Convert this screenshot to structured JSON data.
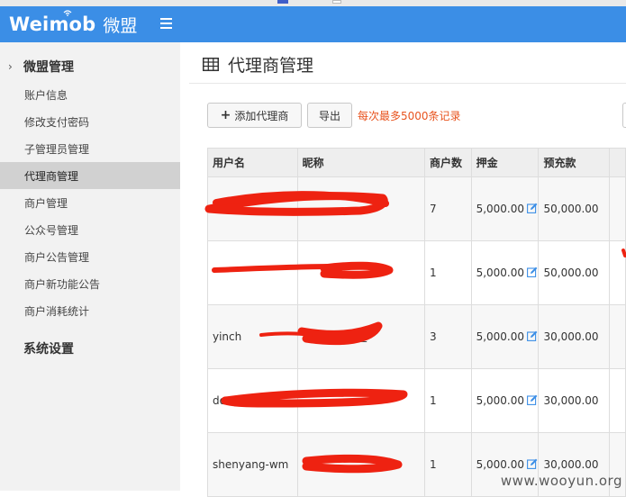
{
  "app": {
    "brand": "Weimob",
    "brand_cn": "微盟"
  },
  "sidebar": {
    "section1": "微盟管理",
    "items": [
      {
        "label": "账户信息"
      },
      {
        "label": "修改支付密码"
      },
      {
        "label": "子管理员管理"
      },
      {
        "label": "代理商管理"
      },
      {
        "label": "商户管理"
      },
      {
        "label": "公众号管理"
      },
      {
        "label": "商户公告管理"
      },
      {
        "label": "商户新功能公告"
      },
      {
        "label": "商户消耗统计"
      }
    ],
    "section2": "系统设置"
  },
  "main": {
    "title": "代理商管理",
    "add_button": "添加代理商",
    "export_button": "导出",
    "hint": "每次最多5000条记录"
  },
  "table": {
    "headers": [
      "用户名",
      "昵称",
      "商户数",
      "押金",
      "预充款"
    ],
    "rows": [
      {
        "username": "",
        "nickname": "",
        "merchants": "7",
        "deposit": "5,000.00",
        "prepay": "50,000.00"
      },
      {
        "username": "",
        "nickname": "",
        "merchants": "1",
        "deposit": "5,000.00",
        "prepay": "50,000.00"
      },
      {
        "username": "yinch",
        "nickname": "理",
        "merchants": "3",
        "deposit": "5,000.00",
        "prepay": "30,000.00"
      },
      {
        "username": "donggua",
        "nickname": "",
        "merchants": "1",
        "deposit": "5,000.00",
        "prepay": "30,000.00"
      },
      {
        "username": "shenyang-wm",
        "nickname": "",
        "merchants": "1",
        "deposit": "5,000.00",
        "prepay": "30,000.00"
      }
    ]
  },
  "watermark": "www.wooyun.org",
  "colors": {
    "header": "#3b8ee6",
    "hint": "#e8541f",
    "redaction": "#ee2211"
  }
}
